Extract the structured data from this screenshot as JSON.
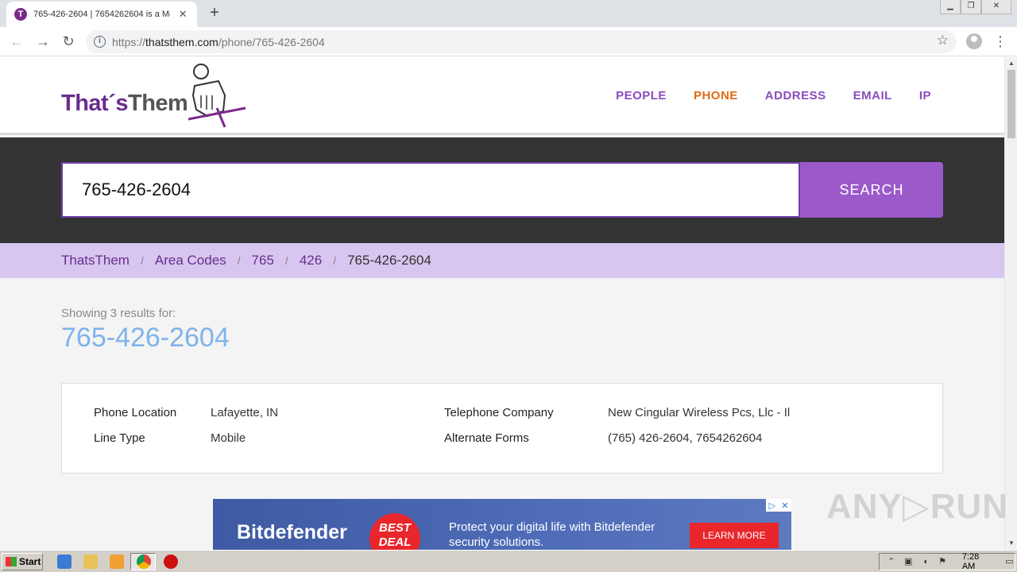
{
  "browser": {
    "tab_title": "765-426-2604 | 7654262604 is a Mo",
    "tab_favicon": "T",
    "url_scheme": "https://",
    "url_host": "thatsthem.com",
    "url_path": "/phone/765-426-2604"
  },
  "site": {
    "logo_that": "That´s",
    "logo_them": "Them",
    "nav": [
      "PEOPLE",
      "PHONE",
      "ADDRESS",
      "EMAIL",
      "IP"
    ],
    "nav_active": "PHONE",
    "accent_color": "#9b59c9",
    "active_color": "#e06a17"
  },
  "search": {
    "value": "765-426-2604",
    "button_label": "SEARCH"
  },
  "breadcrumb": {
    "items": [
      "ThatsThem",
      "Area Codes",
      "765",
      "426"
    ],
    "current": "765-426-2604",
    "separator": "/"
  },
  "results": {
    "caption": "Showing 3 results for:",
    "number": "765-426-2604"
  },
  "info": {
    "phone_location_label": "Phone Location",
    "phone_location_value": "Lafayette, IN",
    "line_type_label": "Line Type",
    "line_type_value": "Mobile",
    "telephone_company_label": "Telephone Company",
    "telephone_company_value": "New Cingular Wireless Pcs, Llc - Il",
    "alternate_forms_label": "Alternate Forms",
    "alternate_forms_value": "(765) 426-2604, 7654262604"
  },
  "ad": {
    "brand": "Bitdefender",
    "badge_line1": "BEST",
    "badge_line2": "DEAL",
    "text": "Protect your digital life with Bitdefender security solutions.",
    "cta": "LEARN MORE"
  },
  "watermark": "ANY▷RUN",
  "taskbar": {
    "start_label": "Start",
    "clock": "7:28 AM"
  }
}
